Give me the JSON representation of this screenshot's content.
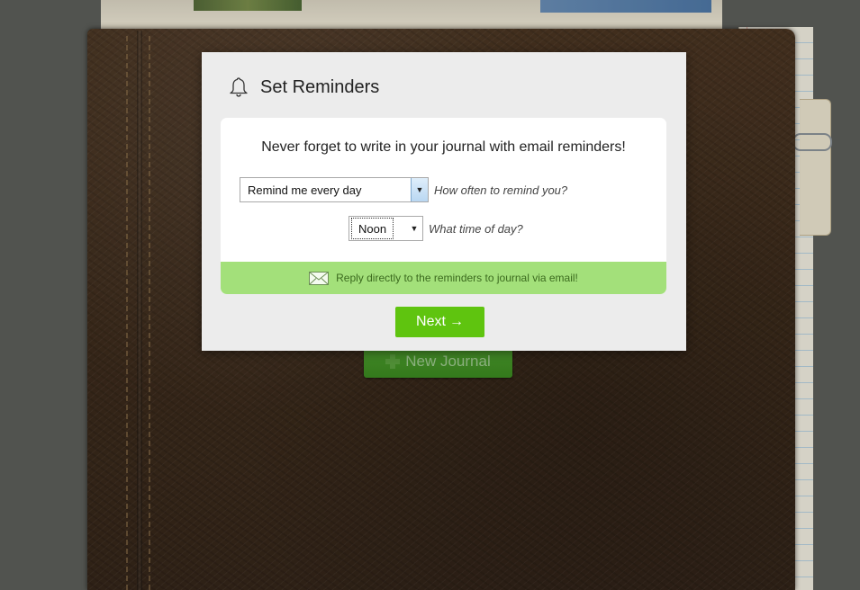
{
  "background": {
    "new_journal_label": "New Journal"
  },
  "modal": {
    "title": "Set Reminders",
    "headline": "Never forget to write in your journal with email reminders!",
    "frequency": {
      "selected": "Remind me every day",
      "hint": "How often to remind you?"
    },
    "time": {
      "selected": "Noon",
      "hint": "What time of day?"
    },
    "banner": {
      "text": "Reply directly to the reminders to journal via email!",
      "icon": "envelope-icon"
    },
    "next_button": {
      "label": "Next",
      "arrow": "→"
    }
  },
  "colors": {
    "accent_green": "#5fc40f",
    "banner_green": "#a3e07a",
    "leather": "#3e2c1c"
  }
}
